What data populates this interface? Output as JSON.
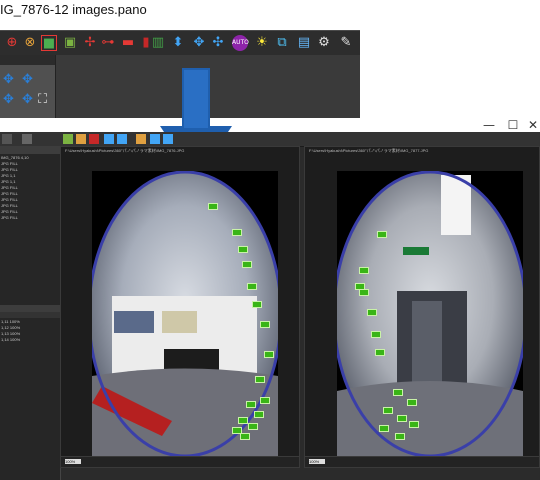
{
  "inset": {
    "title": "IG_7876-12 images.pano",
    "toolbar_icons": [
      "crosshair-icon",
      "stitch-icon",
      "fill-icon",
      "adjust-icon",
      "export-icon",
      "grid-icon",
      "edit-icon",
      "levels-icon",
      "fullscreen-icon",
      "navigate-icon",
      "nodes-icon",
      "target-icon",
      "auto-icon",
      "rainbow-icon",
      "layers-icon",
      "project-icon",
      "settings-icon",
      "wrench-icon"
    ],
    "panel_glyphs": [
      "↕",
      "◆",
      "◆",
      "⤢"
    ]
  },
  "window_buttons": {
    "minimize": "—",
    "maximize": "☐",
    "close": "✕"
  },
  "app": {
    "list_rows": [
      "IMG_7876  4,10",
      "JPG  FILL",
      "JPG  FILL",
      "JPG  1,1",
      "JPG  1,1",
      "JPG  FILL",
      "JPG  FILL",
      "JPG  FILL",
      "JPG  FILL",
      "JPG  FILL",
      "JPG  FILL"
    ],
    "lower_rows": [
      "1,11  100%",
      "1,12  100%",
      "1,13  100%",
      "1,14  100%"
    ],
    "left_viewer_path": "F:\\Users\\Hyakushi\\Pictures\\360°パノ\\パノラマ素材\\IMG_7876.JPG",
    "right_viewer_path": "F:\\Users\\Hyakushi\\Pictures\\360°パノ\\パノラマ素材\\IMG_7877.JPG",
    "zoom_label": "100%",
    "status_label": "Ref"
  }
}
